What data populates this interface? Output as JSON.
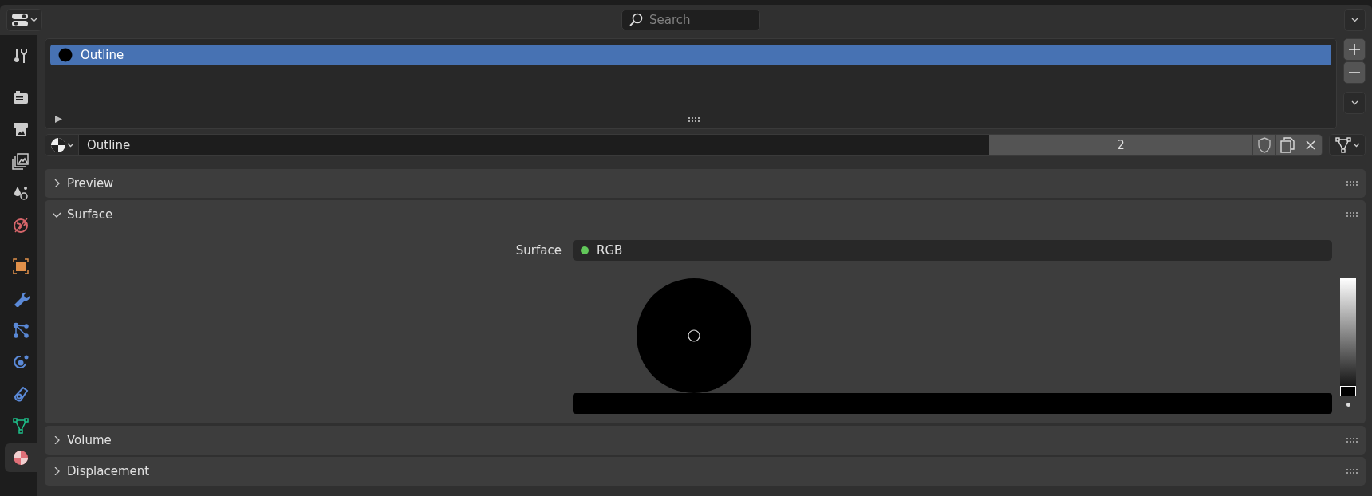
{
  "header": {
    "search": {
      "placeholder": "Search"
    }
  },
  "sidebar": {
    "tabs": [
      {
        "kind": "tool",
        "selected": false
      },
      {
        "kind": "render",
        "selected": false
      },
      {
        "kind": "output",
        "selected": false
      },
      {
        "kind": "view_layer",
        "selected": false
      },
      {
        "kind": "scene",
        "selected": false
      },
      {
        "kind": "world",
        "selected": false
      },
      {
        "kind": "object",
        "selected": false
      },
      {
        "kind": "modifiers",
        "selected": false
      },
      {
        "kind": "particles",
        "selected": false
      },
      {
        "kind": "physics",
        "selected": false
      },
      {
        "kind": "constraints",
        "selected": false
      },
      {
        "kind": "data",
        "selected": false
      },
      {
        "kind": "material",
        "selected": true
      }
    ]
  },
  "material_slots": {
    "items": [
      {
        "name": "Outline",
        "selected": true
      }
    ]
  },
  "datablock": {
    "name": "Outline",
    "users": "2"
  },
  "panels": [
    {
      "title": "Preview",
      "expanded": false
    },
    {
      "title": "Surface",
      "expanded": true,
      "surface": {
        "label": "Surface",
        "value": "RGB",
        "color_value": {
          "level": 0
        }
      }
    },
    {
      "title": "Volume",
      "expanded": false
    },
    {
      "title": "Displacement",
      "expanded": false
    }
  ]
}
